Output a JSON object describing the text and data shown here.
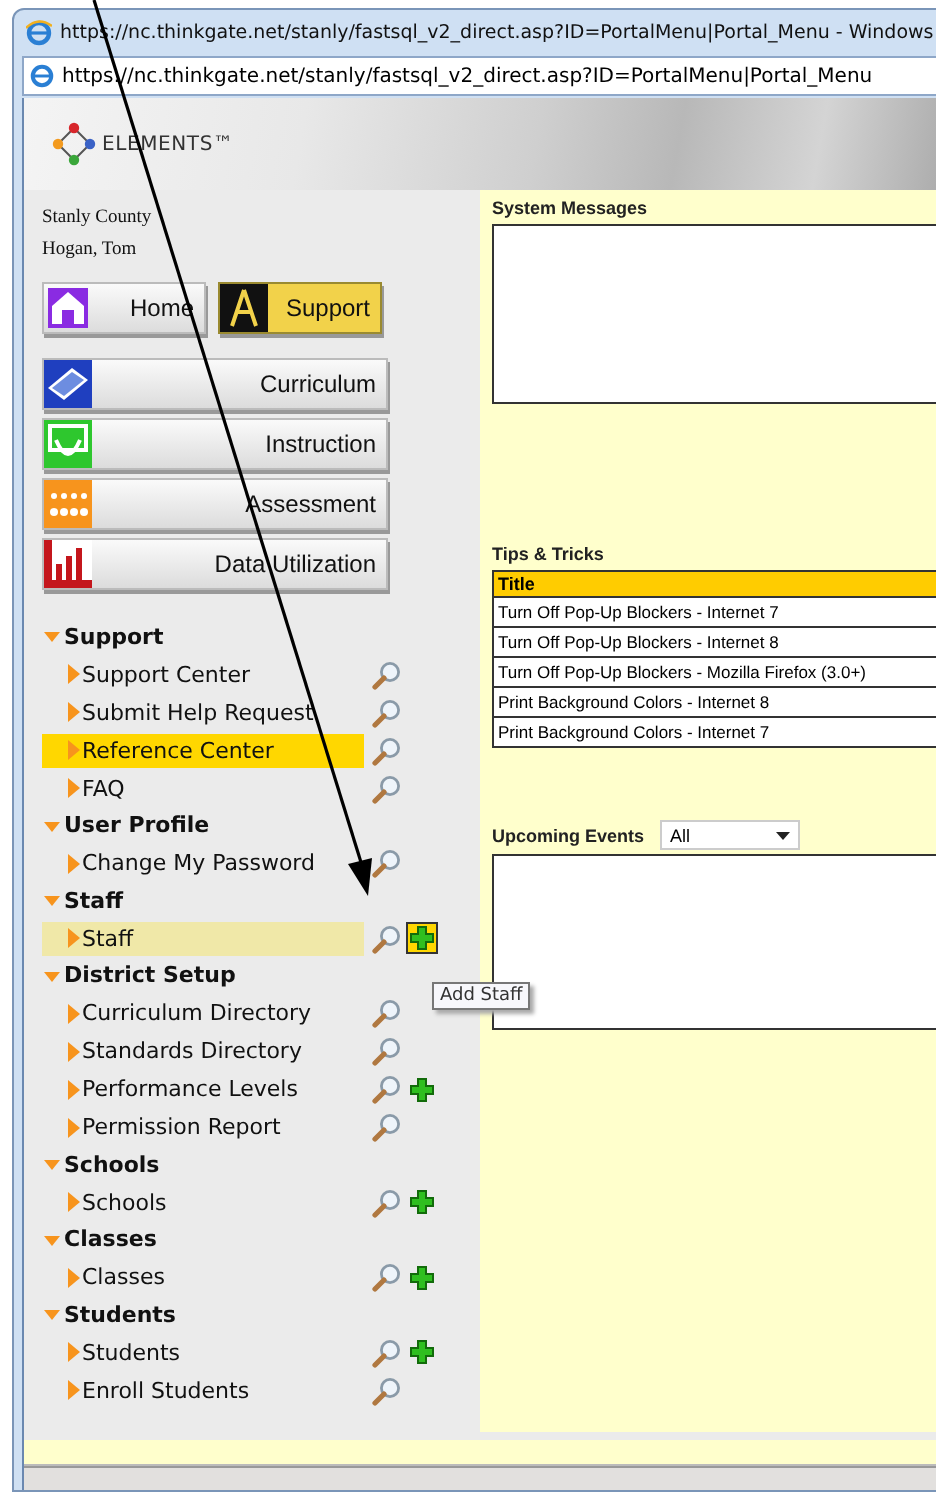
{
  "window": {
    "title": "https://nc.thinkgate.net/stanly/fastsql_v2_direct.asp?ID=PortalMenu|Portal_Menu - Windows",
    "address": "https://nc.thinkgate.net/stanly/fastsql_v2_direct.asp?ID=PortalMenu|Portal_Menu"
  },
  "banner": {
    "logo": "ELEMENTS™"
  },
  "user": {
    "district": "Stanly County",
    "name": "Hogan, Tom"
  },
  "top_buttons": [
    {
      "label": "Home",
      "kind": "home",
      "selected": false
    },
    {
      "label": "Support",
      "kind": "support",
      "selected": true
    }
  ],
  "modules": [
    {
      "label": "Curriculum",
      "kind": "curriculum"
    },
    {
      "label": "Instruction",
      "kind": "instruction"
    },
    {
      "label": "Assessment",
      "kind": "assessment"
    },
    {
      "label": "Data Utilization",
      "kind": "data"
    }
  ],
  "menu": [
    {
      "label": "Support",
      "expanded": true,
      "children": [
        {
          "label": "Support Center",
          "add": false,
          "selected": false,
          "hovered": false
        },
        {
          "label": "Submit Help Request",
          "add": false,
          "selected": false,
          "hovered": false
        },
        {
          "label": "Reference Center",
          "add": false,
          "selected": true,
          "hovered": false
        },
        {
          "label": "FAQ",
          "add": false,
          "selected": false,
          "hovered": false
        }
      ]
    },
    {
      "label": "User Profile",
      "expanded": true,
      "children": [
        {
          "label": "Change My Password",
          "add": false,
          "selected": false,
          "hovered": false
        }
      ]
    },
    {
      "label": "Staff",
      "expanded": true,
      "children": [
        {
          "label": "Staff",
          "add": true,
          "selected": false,
          "hovered": true
        }
      ]
    },
    {
      "label": "District Setup",
      "expanded": true,
      "children": [
        {
          "label": "Curriculum Directory",
          "add": false,
          "selected": false,
          "hovered": false
        },
        {
          "label": "Standards Directory",
          "add": false,
          "selected": false,
          "hovered": false
        },
        {
          "label": "Performance Levels",
          "add": true,
          "selected": false,
          "hovered": false
        },
        {
          "label": "Permission Report",
          "add": false,
          "selected": false,
          "hovered": false
        }
      ]
    },
    {
      "label": "Schools",
      "expanded": true,
      "children": [
        {
          "label": "Schools",
          "add": true,
          "selected": false,
          "hovered": false
        }
      ]
    },
    {
      "label": "Classes",
      "expanded": true,
      "children": [
        {
          "label": "Classes",
          "add": true,
          "selected": false,
          "hovered": false
        }
      ]
    },
    {
      "label": "Students",
      "expanded": true,
      "children": [
        {
          "label": "Students",
          "add": true,
          "selected": false,
          "hovered": false
        },
        {
          "label": "Enroll Students",
          "add": false,
          "selected": false,
          "hovered": false
        }
      ]
    }
  ],
  "tooltip": {
    "text": "Add Staff"
  },
  "system_messages": {
    "title": "System Messages"
  },
  "tips": {
    "title": "Tips & Tricks",
    "column": "Title",
    "rows": [
      "Turn Off Pop-Up Blockers - Internet 7",
      "Turn Off Pop-Up Blockers - Internet 8",
      "Turn Off Pop-Up Blockers - Mozilla Firefox (3.0+)",
      "Print Background Colors - Internet 8",
      "Print Background Colors - Internet 7"
    ]
  },
  "events": {
    "title": "Upcoming Events",
    "filter": "All"
  }
}
